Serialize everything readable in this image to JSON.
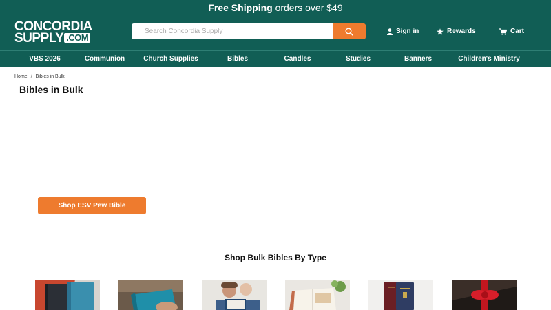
{
  "promo": {
    "bold": "Free Shipping",
    "rest": " orders over $49"
  },
  "logo": {
    "line1": "CONCORDIA",
    "line2": "SUPPLY",
    "suffix": ".COM"
  },
  "search": {
    "placeholder": "Search Concordia Supply",
    "icon": "search-icon"
  },
  "header_links": [
    {
      "label": "Sign in",
      "icon": "user-icon"
    },
    {
      "label": "Rewards",
      "icon": "star-icon"
    },
    {
      "label": "Cart",
      "icon": "cart-icon"
    }
  ],
  "nav": [
    "VBS 2026",
    "Communion",
    "Church Supplies",
    "Bibles",
    "Candles",
    "Studies",
    "Banners",
    "Children's Ministry"
  ],
  "breadcrumb": {
    "home": "Home",
    "separator": "/",
    "current": "Bibles in Bulk"
  },
  "page_title": "Bibles in Bulk",
  "cta": "Shop ESV Pew Bible",
  "section_title": "Shop Bulk Bibles By Type",
  "colors": {
    "brand": "#115e55",
    "accent": "#ee7b2e"
  }
}
